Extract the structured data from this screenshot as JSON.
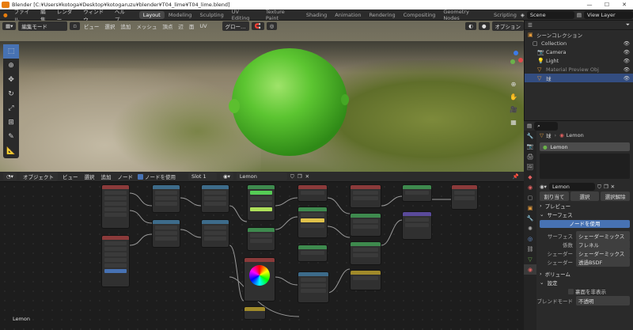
{
  "window": {
    "title": "Blender [C:¥Users¥kotoga¥Desktop¥kotogaruzu¥blender¥T04_lime¥T04_lime.blend]",
    "min": "—",
    "max": "☐",
    "close": "✕"
  },
  "menus": [
    "ファイル",
    "編集",
    "レンダー",
    "ウィンドウ",
    "ヘルプ"
  ],
  "workspaces": [
    "Layout",
    "Modeling",
    "Sculpting",
    "UV Editing",
    "Texture Paint",
    "Shading",
    "Animation",
    "Rendering",
    "Compositing",
    "Geometry Nodes",
    "Scripting"
  ],
  "active_workspace": "Layout",
  "scene": {
    "label": "Scene",
    "view_layer": "View Layer"
  },
  "viewport": {
    "mode": "編集モード",
    "menus": [
      "ビュー",
      "選択",
      "追加",
      "メッシュ",
      "頂点",
      "辺",
      "面",
      "UV"
    ],
    "transform": "グロー…",
    "options": "オプション"
  },
  "tools": [
    "select",
    "cursor",
    "move",
    "rotate",
    "scale",
    "transform",
    "annotate",
    "measure"
  ],
  "node_editor": {
    "object_type": "オブジェクト",
    "menus": [
      "ビュー",
      "選択",
      "追加",
      "ノード"
    ],
    "use_nodes": "ノードを使用",
    "slot": "Slot 1",
    "material": "Lemon",
    "footer": "Lemon"
  },
  "outliner": {
    "header": "シーンコレクション",
    "items": [
      {
        "label": "Collection",
        "icon": "collection-icon"
      },
      {
        "label": "Camera",
        "icon": "camera-icon"
      },
      {
        "label": "Light",
        "icon": "light-icon"
      },
      {
        "label": "Material Preview Obj",
        "icon": "object-icon"
      },
      {
        "label": "球",
        "icon": "mesh-icon"
      }
    ]
  },
  "properties": {
    "object": "球",
    "material_header": "Lemon",
    "slot_item": "Lemon",
    "material_field": "Lemon",
    "buttons": [
      "割り当て",
      "選択",
      "選択解除"
    ],
    "sections": {
      "preview": "プレビュー",
      "surface": "サーフェス",
      "volume": "ボリューム",
      "settings": "設定"
    },
    "use_nodes_btn": "ノードを使用",
    "surface": [
      {
        "k": "サーフェス",
        "v": "シェーダーミックス"
      },
      {
        "k": "係数",
        "v": "フレネル"
      },
      {
        "k": "シェーダー",
        "v": "シェーダーミックス"
      },
      {
        "k": "シェーダー",
        "v": "透過BSDF"
      }
    ],
    "backface": "裏面を非表示",
    "blend_mode": {
      "k": "ブレンドモード",
      "v": "不透明"
    }
  }
}
